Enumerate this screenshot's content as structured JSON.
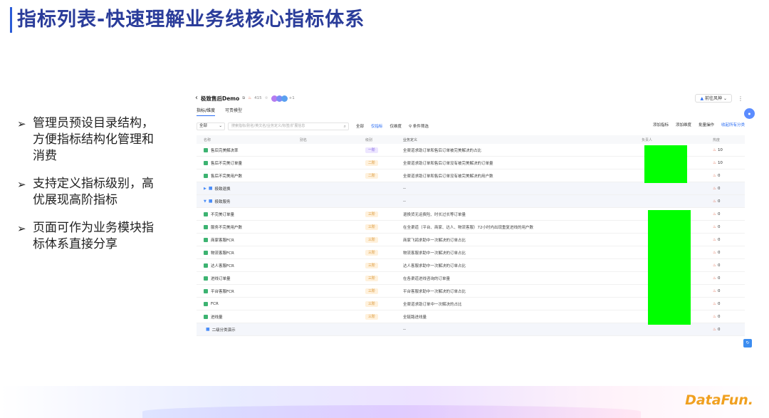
{
  "slide": {
    "title": "指标列表-快速理解业务线核心指标体系",
    "bullets": [
      "管理员预设目录结构，方便指标结构化管理和消费",
      "支持定义指标级别，高优展现高阶指标",
      "页面可作为业务模块指标体系直接分享"
    ],
    "logo": "DataFun."
  },
  "app": {
    "title": "极致售后Demo",
    "count": "415",
    "avatars_more": "+1",
    "goto_label": "前往风神",
    "tabs": [
      {
        "label": "指标/维度",
        "active": true
      },
      {
        "label": "可责模型",
        "active": false
      }
    ],
    "toolbar": {
      "select_value": "全部",
      "search_placeholder": "搜索指标/别名/英文名/业务定义/标签/扩展信息",
      "filters": [
        "全部",
        "仅指标",
        "仅维度",
        "条件筛选"
      ],
      "actions": [
        "添加指标",
        "添加维度",
        "批量操作",
        "收起所有分类"
      ]
    },
    "columns": [
      "名称",
      "别名",
      "级别",
      "业务定义",
      "负责人",
      "热度"
    ],
    "rows": [
      {
        "type": "metric",
        "name": "售后完美解决率",
        "level": "一阶",
        "definition": "全渠道求助订单和售后订单被完美解决的占比",
        "hot": "10"
      },
      {
        "type": "metric",
        "name": "售后不完美订单量",
        "level": "二阶",
        "definition": "全渠道求助订单和售后订单没有被完美解决的订单量",
        "hot": "10"
      },
      {
        "type": "metric",
        "name": "售后不完美用户数",
        "level": "二阶",
        "definition": "全渠道求助订单和售后订单没有被完美解决的用户数",
        "hot": "0"
      },
      {
        "type": "group",
        "name": "极致退换",
        "level": "",
        "definition": "--",
        "hot": "0"
      },
      {
        "type": "group",
        "name": "极致服务",
        "level": "",
        "definition": "--",
        "hot": "0"
      },
      {
        "type": "metric",
        "name": "不完美订单量",
        "level": "三阶",
        "definition": "退换货无运费险、时长过长等订单量",
        "hot": "0"
      },
      {
        "type": "metric",
        "name": "服务不完美用户数",
        "level": "三阶",
        "definition": "在全渠道（平台、商家、达人、物流客服）72小时内出现重复进线的用户数",
        "hot": "0"
      },
      {
        "type": "metric",
        "name": "商家客服FCR",
        "level": "三阶",
        "definition": "商家飞鸽求助中一次解决的订单占比",
        "hot": "0"
      },
      {
        "type": "metric",
        "name": "物流客服FCR",
        "level": "三阶",
        "definition": "物流客服求助中一次解决的订单占比",
        "hot": "0"
      },
      {
        "type": "metric",
        "name": "达人客服FCR",
        "level": "三阶",
        "definition": "达人客服求助中一次解决的订单占比",
        "hot": "0"
      },
      {
        "type": "metric",
        "name": "进线订单量",
        "level": "三阶",
        "definition": "在各渠道进线咨询的订单量",
        "hot": "0"
      },
      {
        "type": "metric",
        "name": "平台客服FCR",
        "level": "三阶",
        "definition": "平台客服求助中一次解决的订单占比",
        "hot": "0"
      },
      {
        "type": "metric",
        "name": "FCR",
        "level": "三阶",
        "definition": "全渠道求助订单中一次解决的占比",
        "hot": "0"
      },
      {
        "type": "metric",
        "name": "进线量",
        "level": "三阶",
        "definition": "全链路进线量",
        "hot": "0"
      },
      {
        "type": "group",
        "name": "二级分类演示",
        "level": "",
        "definition": "--",
        "hot": "0"
      }
    ]
  },
  "colors": {
    "title": "#2a3c9a",
    "accent": "#2a6df4",
    "redaction": "#00ff00",
    "logo": "#f0a020"
  }
}
